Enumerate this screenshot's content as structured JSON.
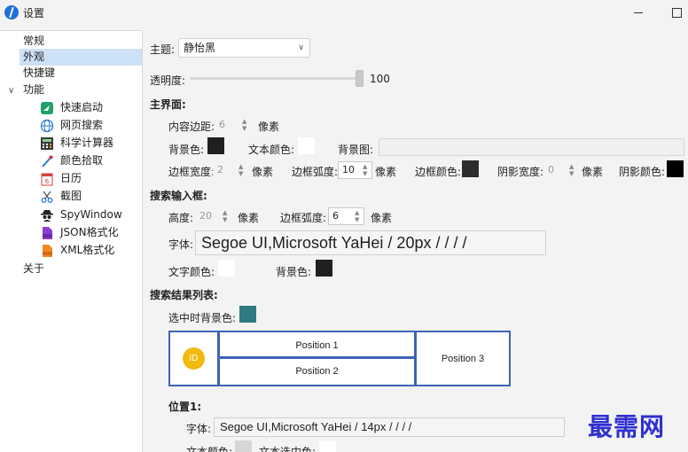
{
  "window": {
    "title": "设置"
  },
  "sidebar": {
    "items": [
      {
        "label": "常规"
      },
      {
        "label": "外观"
      },
      {
        "label": "快捷键"
      },
      {
        "label": "功能"
      },
      {
        "label": "快速启动",
        "icon": "rocket-icon"
      },
      {
        "label": "网页搜索",
        "icon": "globe-icon"
      },
      {
        "label": "科学计算器",
        "icon": "calculator-icon"
      },
      {
        "label": "颜色拾取",
        "icon": "eyedropper-icon"
      },
      {
        "label": "日历",
        "icon": "calendar-icon",
        "icon_text": "6"
      },
      {
        "label": "截图",
        "icon": "scissors-icon"
      },
      {
        "label": "SpyWindow",
        "icon": "spy-icon"
      },
      {
        "label": "JSON格式化",
        "icon": "json-file-icon"
      },
      {
        "label": "XML格式化",
        "icon": "xml-file-icon"
      },
      {
        "label": "关于"
      }
    ]
  },
  "theme": {
    "label": "主题:",
    "value": "静怡黑"
  },
  "opacity": {
    "label": "透明度:",
    "value": "100",
    "level": 1.0
  },
  "main_ui": {
    "heading": "主界面:",
    "padding_label": "内容边距:",
    "padding_value": "6",
    "padding_unit": "像素",
    "bg_color_label": "背景色:",
    "bg_color": "#202020",
    "text_color_label": "文本颜色:",
    "text_color": "#ffffff",
    "bg_image_label": "背景图:",
    "border_width_label": "边框宽度:",
    "border_width_value": "2",
    "border_width_unit": "像素",
    "border_radius_label": "边框弧度:",
    "border_radius_value": "10",
    "border_radius_unit": "像素",
    "border_color_label": "边框颜色:",
    "border_color": "#2d2d2d",
    "shadow_width_label": "阴影宽度:",
    "shadow_width_value": "0",
    "shadow_width_unit": "像素",
    "shadow_color_label": "阴影颜色:",
    "shadow_color": "#000000"
  },
  "search_box": {
    "heading": "搜索输入框:",
    "height_label": "高度:",
    "height_value": "20",
    "height_unit": "像素",
    "radius_label": "边框弧度:",
    "radius_value": "6",
    "radius_unit": "像素",
    "font_label": "字体:",
    "font_value": "Segoe UI,Microsoft YaHei / 20px /  /  /  /",
    "text_color_label": "文字颜色:",
    "text_color": "#ffffff",
    "bg_color_label": "背景色:",
    "bg_color": "#202020"
  },
  "result_list": {
    "heading": "搜索结果列表:",
    "selected_bg_label": "选中时背景色:",
    "selected_bg": "#2e7a80",
    "preview": {
      "id": "ID",
      "p1": "Position 1",
      "p2": "Position 2",
      "p3": "Position 3"
    }
  },
  "position1": {
    "heading": "位置1:",
    "font_label": "字体:",
    "font_value": "Segoe UI,Microsoft YaHei / 14px /  /  /  /",
    "text_color_label": "文本颜色:",
    "text_color": "#d6d6d6",
    "selected_text_color_label": "文本选中色:",
    "selected_text_color": "#ffffff"
  },
  "watermark": "最需网",
  "colors": {
    "selection": "#cde2f7",
    "preview_border": "#3c64b4",
    "id_badge": "#f2b90f"
  }
}
